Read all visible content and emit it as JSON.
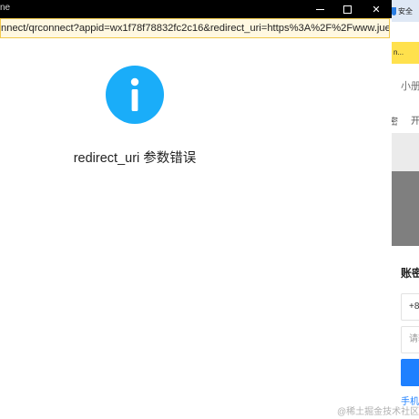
{
  "popup": {
    "window_title_fragment": "ne",
    "address_url": "nnect/qrconnect?appid=wx1f78f78832fc2c16&redirect_uri=https%3A%2F%2Fwww.jue...",
    "error_message": "redirect_uri 参数错误",
    "info_icon": "info-circle-icon",
    "info_icon_color": "#1aadf9"
  },
  "background_page": {
    "security_label": "安全",
    "yellow_bar_text": "n...",
    "header_text": "小册",
    "nav_left_text": "密",
    "nav_right_text": "开",
    "modal_title": "账密",
    "phone_prefix": "+8",
    "code_placeholder": "请输",
    "link_text": "手机",
    "accent_color": "#1e80ff"
  },
  "watermark": "@稀土掘金技术社区"
}
